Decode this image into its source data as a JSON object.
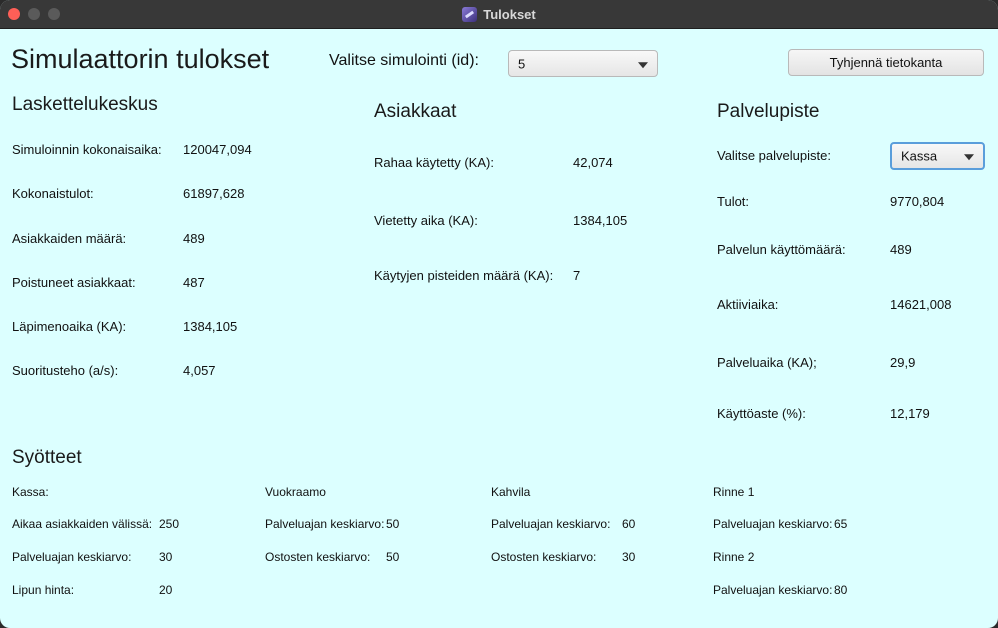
{
  "window": {
    "title": "Tulokset"
  },
  "header": {
    "title": "Simulaattorin tulokset",
    "select_label": "Valitse simulointi (id):",
    "select_value": "5",
    "clear_button": "Tyhjennä tietokanta"
  },
  "laskettelukeskus": {
    "title": "Laskettelukeskus",
    "rows": [
      {
        "label": "Simuloinnin kokonaisaika:",
        "value": "120047,094"
      },
      {
        "label": "Kokonaistulot:",
        "value": "61897,628"
      },
      {
        "label": "Asiakkaiden määrä:",
        "value": "489"
      },
      {
        "label": "Poistuneet asiakkaat:",
        "value": "487"
      },
      {
        "label": "Läpimenoaika (KA):",
        "value": "1384,105"
      },
      {
        "label": "Suoritusteho (a/s):",
        "value": "4,057"
      }
    ]
  },
  "asiakkaat": {
    "title": "Asiakkaat",
    "rows": [
      {
        "label": "Rahaa käytetty (KA):",
        "value": "42,074"
      },
      {
        "label": "Vietetty aika (KA):",
        "value": "1384,105"
      },
      {
        "label": "Käytyjen pisteiden määrä (KA):",
        "value": "7"
      }
    ]
  },
  "palvelupiste": {
    "title": "Palvelupiste",
    "select_label": "Valitse palvelupiste:",
    "select_value": "Kassa",
    "rows": [
      {
        "label": "Tulot:",
        "value": "9770,804"
      },
      {
        "label": "Palvelun käyttömäärä:",
        "value": "489"
      },
      {
        "label": "Aktiiviaika:",
        "value": "14621,008"
      },
      {
        "label": "Palveluaika (KA);",
        "value": "29,9"
      },
      {
        "label": "Käyttöaste (%):",
        "value": "12,179"
      }
    ]
  },
  "syotteet": {
    "title": "Syötteet",
    "kassa": {
      "title": "Kassa:",
      "rows": [
        {
          "label": "Aikaa asiakkaiden välissä:",
          "value": "250"
        },
        {
          "label": "Palveluajan keskiarvo:",
          "value": "30"
        },
        {
          "label": "Lipun hinta:",
          "value": "20"
        }
      ]
    },
    "vuokraamo": {
      "title": "Vuokraamo",
      "rows": [
        {
          "label": "Palveluajan keskiarvo:",
          "value": "50"
        },
        {
          "label": "Ostosten keskiarvo:",
          "value": "50"
        }
      ]
    },
    "kahvila": {
      "title": "Kahvila",
      "rows": [
        {
          "label": "Palveluajan keskiarvo:",
          "value": "60"
        },
        {
          "label": "Ostosten keskiarvo:",
          "value": "30"
        }
      ]
    },
    "rinne1": {
      "title": "Rinne 1",
      "label": "Palveluajan keskiarvo:",
      "value": "65"
    },
    "rinne2": {
      "title": "Rinne 2",
      "label": "Palveluajan keskiarvo:",
      "value": "80"
    }
  }
}
